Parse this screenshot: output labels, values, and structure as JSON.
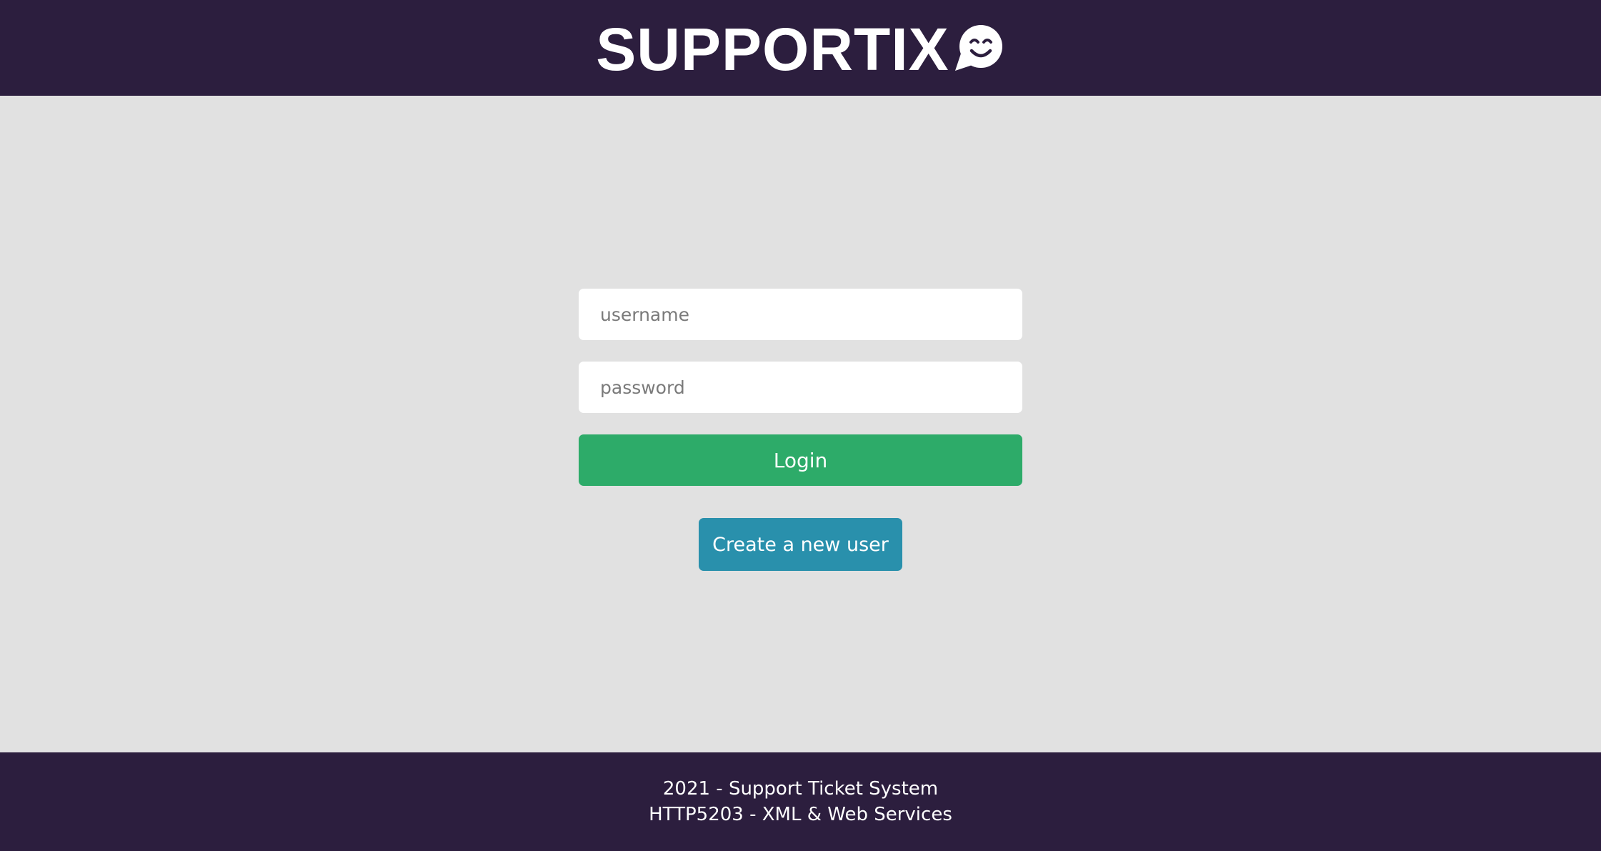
{
  "header": {
    "logo_text": "SUPPORTIX",
    "logo_icon": "smiley-chat-bubble-icon",
    "background_color": "#2c1e3e"
  },
  "login_form": {
    "username_placeholder": "username",
    "password_placeholder": "password",
    "login_label": "Login",
    "login_color": "#2dab69"
  },
  "create_user": {
    "label": "Create a new user",
    "color": "#2990ac"
  },
  "footer": {
    "line1": "2021 - Support Ticket System",
    "line2": "HTTP5203 - XML & Web Services"
  }
}
